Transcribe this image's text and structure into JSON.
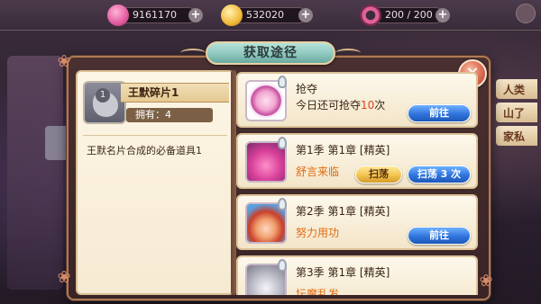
{
  "topbar": {
    "resources": [
      {
        "icon": "heart-gem-icon",
        "value": "9161170",
        "color": "#e25aa0"
      },
      {
        "icon": "gold-coin-icon",
        "value": "532020",
        "color": "#f2b93a"
      },
      {
        "icon": "stamina-ring-icon",
        "value": "200 / 200",
        "color": "#e0609a"
      }
    ]
  },
  "background_tabs": [
    "人类",
    "山了",
    "家私"
  ],
  "popup": {
    "title": "获取途径",
    "close_symbol": "✕"
  },
  "item": {
    "badge": "1",
    "name": "王默碎片1",
    "owned": "拥有：4",
    "description": "王默名片合成的必备道具1"
  },
  "sources": [
    {
      "thumb_icon": "plunder-heart-icon",
      "title": "抢夺",
      "subtitle_prefix": "今日还可抢夺",
      "subtitle_count": "10",
      "subtitle_suffix": "次",
      "go_label": "前往"
    },
    {
      "thumb_icon": "pink-monster-portrait-icon",
      "title": "第1季 第1章 [精英]",
      "subtitle": "舒言来临",
      "sweep_label": "扫荡",
      "sweep3_label": "扫荡 3 次"
    },
    {
      "thumb_icon": "redhair-girl-portrait-icon",
      "title": "第2季 第1章 [精英]",
      "subtitle": "努力用功",
      "go_label": "前往"
    },
    {
      "thumb_icon": "silverhair-portrait-icon",
      "title": "第3季 第1章 [精英]",
      "subtitle": "坛魔乱发"
    }
  ],
  "colors": {
    "accent_blue": "#2f74dc",
    "accent_gold": "#f2c450",
    "highlight": "#e0401a",
    "panel_bg": "#fdf6e6"
  }
}
